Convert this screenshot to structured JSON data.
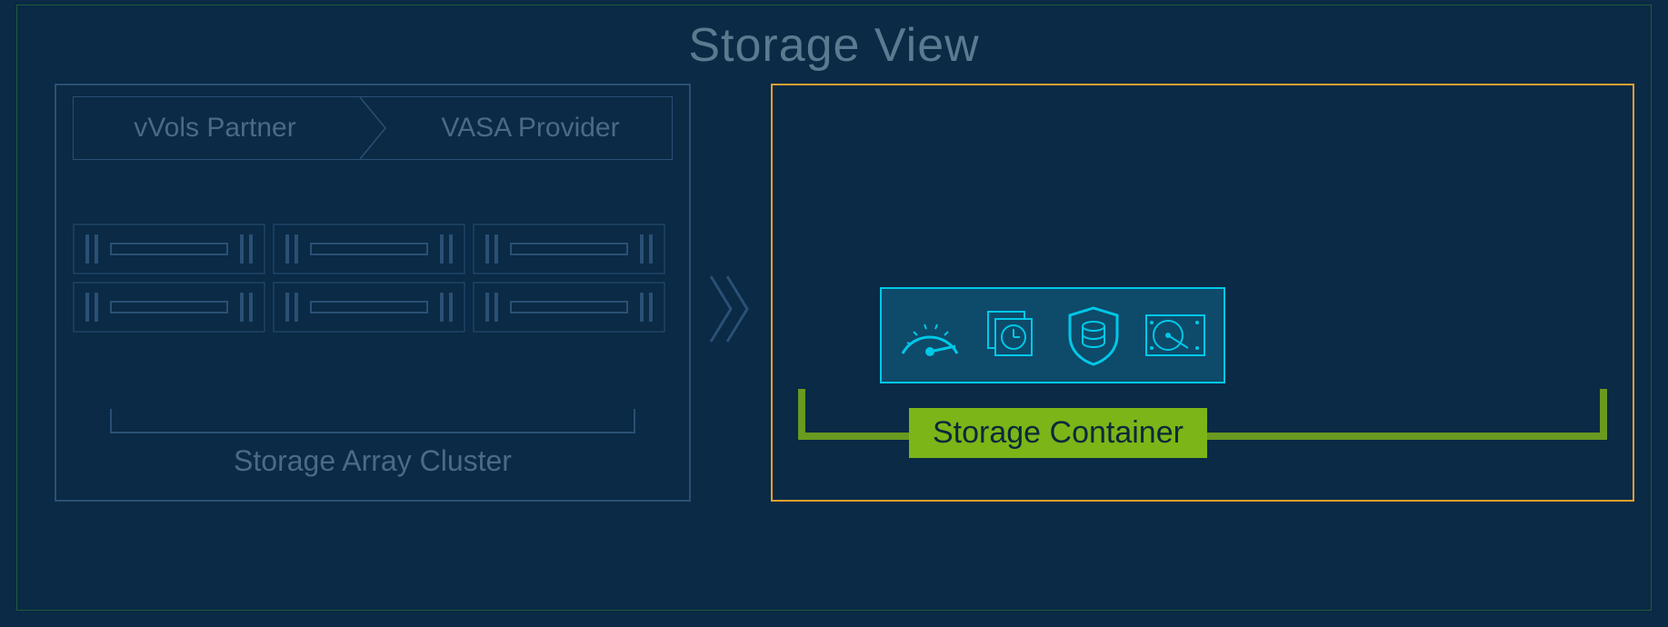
{
  "title": "Storage View",
  "left": {
    "vvols_partner": "vVols Partner",
    "vasa_provider": "VASA Provider",
    "cluster_label": "Storage Array Cluster"
  },
  "right": {
    "container_label": "Storage Container",
    "capabilities": [
      {
        "icon": "gauge-icon"
      },
      {
        "icon": "snapshot-clock-icon"
      },
      {
        "icon": "shield-database-icon"
      },
      {
        "icon": "hard-drive-icon"
      }
    ]
  },
  "colors": {
    "highlight_border": "#e8a030",
    "capabilities_accent": "#00c8e8",
    "container_green": "#7cb518"
  }
}
